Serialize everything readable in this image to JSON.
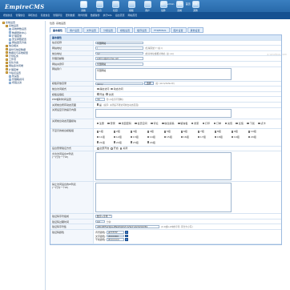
{
  "header": {
    "logo": "EmpireCMS",
    "user_items": [
      "用户: admin",
      "[退出]",
      "首页",
      "帮助"
    ],
    "top_icons": [
      {
        "label": "系统",
        "icon": "system-icon"
      },
      {
        "label": "信息",
        "icon": "info-icon"
      },
      {
        "label": "栏目",
        "icon": "column-icon"
      },
      {
        "label": "模板",
        "icon": "template-icon"
      },
      {
        "label": "用户",
        "icon": "user-icon"
      },
      {
        "label": "插件",
        "icon": "plugin-icon"
      },
      {
        "label": "商城",
        "icon": "shop-icon"
      },
      {
        "label": "其他",
        "icon": "other-icon"
      }
    ],
    "menu_items": [
      "增加信息",
      "管理信息",
      "审核信息",
      "签发信息",
      "管理评论",
      "更新数据",
      "附件管理",
      "数据备份",
      "执行SQL",
      "后台首页",
      "网站首页"
    ]
  },
  "sidebar": {
    "items": [
      {
        "label": "系统设置",
        "level": 1
      },
      {
        "label": "系统设置",
        "level": 2
      },
      {
        "label": "系统参数设置",
        "level": 3
      },
      {
        "label": "数据更新中心",
        "level": 3
      },
      {
        "label": "扩展变量",
        "level": 3
      },
      {
        "label": "安全参数配置",
        "level": 3
      },
      {
        "label": "网站首页方案",
        "level": 3
      },
      {
        "label": "信息相关",
        "level": 2
      },
      {
        "label": "备份与恢复数据",
        "level": 2
      },
      {
        "label": "数据表与系统模型",
        "level": 2
      },
      {
        "label": "计划任务",
        "level": 2
      },
      {
        "label": "工作流",
        "level": 2
      },
      {
        "label": "优化方案",
        "level": 2
      },
      {
        "label": "网站多访问端",
        "level": 2
      },
      {
        "label": "扩展菜单",
        "level": 2
      },
      {
        "label": "分站点设置",
        "level": 2
      },
      {
        "label": "防采集",
        "level": 3
      },
      {
        "label": "管理敏感词",
        "level": 3
      },
      {
        "label": "增强过滤",
        "level": 3
      }
    ]
  },
  "main": {
    "breadcrumb": "位置: 系统设置",
    "tabs": [
      "基本属性",
      "用户设置",
      "文件设置",
      "分级设置",
      "模板设置",
      "缓存设置",
      "FTP/EMAIL",
      "图片设置",
      "其他设置"
    ],
    "watermark": "a.ygyebug.com",
    "form": {
      "section_title": "基本属性",
      "rows": [
        {
          "label": "站点名称",
          "value": "帝国网站",
          "hint": ""
        },
        {
          "label": "网站地址",
          "value": "/",
          "hint": "(结尾需加“/”,如:/)"
        },
        {
          "label": "前台地址",
          "value": "/e/",
          "hint": "(绝对地址或相对地址, 如: /e/)"
        },
        {
          "label": "管理员邮箱",
          "value": "admin@phome.net",
          "hint": ""
        },
        {
          "label": "网站关键字",
          "value": "帝国网站",
          "hint": ""
        },
        {
          "label": "网站简介",
          "value": "帝国网站",
          "hint": ""
        },
        {
          "label": "模板存放目录",
          "value": "/skin/",
          "hint": "(如: /skin/default/)"
        },
        {
          "label": "前台访问模式",
          "options": [
            "静态访问",
            "动态访问"
          ],
          "selected": 0
        },
        {
          "label": "模板后缀名",
          "options": [
            "开启",
            "关闭"
          ],
          "selected": 0
        },
        {
          "label": "PHP超时时间设置",
          "value": "30",
          "hint": "秒 (0表示不限制)"
        },
        {
          "label": "关闭前台所有动态页面",
          "check_label": "是",
          "hint": "(提示: 关闭后不能访问前台动态页面)"
        },
        {
          "label": "关闭后显示的提示内容",
          "value": "",
          "hint": ""
        },
        {
          "label": "关闭前台动态页面模块",
          "checks": [
            "注册",
            "登录",
            "找回密码",
            "会员空间",
            "评论",
            "信息投稿",
            "留言板",
            "搜索",
            "打印",
            "订单",
            "充值",
            "反馈",
            "下载",
            "点卡"
          ]
        },
        {
          "label": "不显示的前台模板组",
          "grid": [
            "1组",
            "2组",
            "3组",
            "4组",
            "5组",
            "6组",
            "7组",
            "8组",
            "9组",
            "10组",
            "11组",
            "12组",
            "13组",
            "14组",
            "15组",
            "16组",
            "17组",
            "18组",
            "19组",
            "20组",
            "21组",
            "22组",
            "23组",
            "24组"
          ]
        },
        {
          "label": "后台登录验证方式",
          "options": [
            "全部开启",
            "开启",
            "关闭"
          ],
          "selected": 0
        },
        {
          "label": "允许访问后台IP列表",
          "sub": "(一行为一个IP)",
          "value": ""
        },
        {
          "label": "禁止访问后台的IP列表",
          "sub": "(一行为一个IP)",
          "value": ""
        },
        {
          "label": "验证码字符组成",
          "select": "数字+字母"
        },
        {
          "label": "验证码过期时间",
          "value": "10",
          "hint": "分钟"
        },
        {
          "label": "验证码字符集",
          "value": "ABCDEFGHIJKLMNOPQRSTUVWXYZ23456789",
          "hint": "(0-9或A-Z中的字符, 区分大小写)"
        },
        {
          "label": "验证码颜色",
          "colors": [
            {
              "label": "背景颜色:",
              "value": "#FFFFFF"
            },
            {
              "label": "文字颜色:",
              "value": "#000000"
            },
            {
              "label": "干扰颜色:",
              "value": "#CCCCCC"
            }
          ]
        }
      ]
    }
  }
}
